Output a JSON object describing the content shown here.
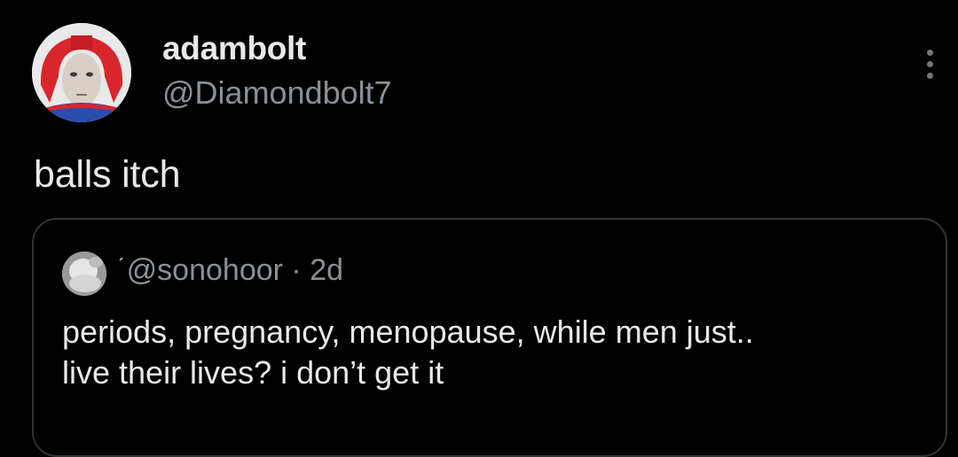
{
  "tweet": {
    "display_name": "adambolt",
    "handle": "@Diamondbolt7",
    "text": "balls itch"
  },
  "quote": {
    "handle": "@sonohoor",
    "separator": "·",
    "time": "2d",
    "line1": "periods, pregnancy, menopause, while men just..",
    "line2": "live their lives? i don’t get it"
  },
  "colors": {
    "background": "#000000",
    "text_primary": "#e7e9ea",
    "text_secondary": "#8b9096",
    "border": "#2f3336"
  },
  "icons": {
    "more": "more-dots-icon"
  }
}
